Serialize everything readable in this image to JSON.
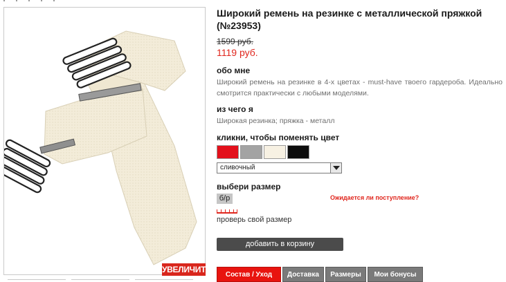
{
  "product": {
    "title": "Широкий ремень на резинке с металлической пряжкой (№23953)",
    "old_price": "1599 руб.",
    "new_price": "1119 руб."
  },
  "gallery": {
    "zoom_label": "УВЕЛИЧИТЬ",
    "image_icon": "belt-product-image"
  },
  "about": {
    "heading": "обо мне",
    "text": "Широкий ремень на резинке в 4-х цветах - must-have твоего гардероба. Идеально смотрится практически с любыми моделями."
  },
  "material": {
    "heading": "из чего я",
    "text": "Широкая резинка; пряжка - металл"
  },
  "colors": {
    "heading": "кликни, чтобы поменять цвет",
    "swatches": [
      {
        "name": "red",
        "hex": "#e3101b"
      },
      {
        "name": "grey",
        "hex": "#a3a3a3"
      },
      {
        "name": "cream",
        "hex": "#f7f1e3"
      },
      {
        "name": "black",
        "hex": "#0d0d0d"
      }
    ],
    "selected": "сливочный"
  },
  "size": {
    "heading": "выбери размер",
    "option": "б/р",
    "awaiting_link": "Ожидается ли поступление?",
    "check_link": "проверь свой размер"
  },
  "cart": {
    "button_label": "добавить в корзину"
  },
  "tabs": [
    {
      "label": "Состав / Уход",
      "active": true
    },
    {
      "label": "Доставка",
      "active": false
    },
    {
      "label": "Размеры",
      "active": false
    },
    {
      "label": "Мои бонусы",
      "active": false
    }
  ]
}
